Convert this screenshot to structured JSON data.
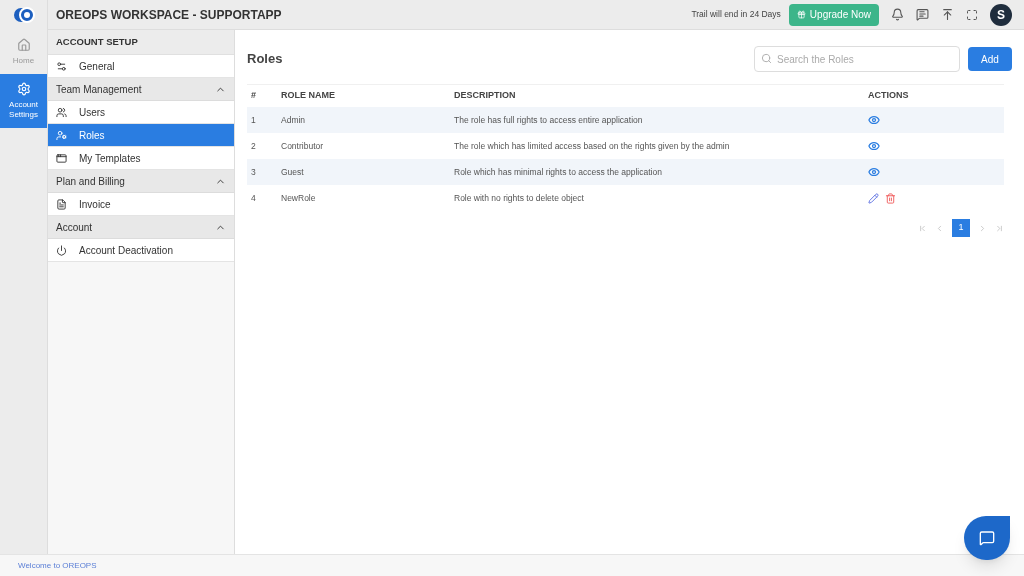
{
  "header": {
    "title": "OREOPS WORKSPACE - SUPPORTAPP",
    "trial_notice": "Trail will end in 24 Days",
    "upgrade_button": "Upgrade Now",
    "avatar": "S"
  },
  "rail": [
    {
      "label": "Home",
      "kind": "home",
      "selected": false
    },
    {
      "label": "Account Settings",
      "kind": "settings",
      "selected": true
    }
  ],
  "sidebar": {
    "title": "ACCOUNT SETUP",
    "top_items": [
      {
        "label": "General",
        "kind": "general",
        "selected": false
      }
    ],
    "sections": [
      {
        "label": "Team Management",
        "expanded": true,
        "items": [
          {
            "label": "Users",
            "kind": "users",
            "selected": false
          },
          {
            "label": "Roles",
            "kind": "roles",
            "selected": true
          },
          {
            "label": "My Templates",
            "kind": "templates",
            "selected": false
          }
        ]
      },
      {
        "label": "Plan and Billing",
        "expanded": true,
        "items": [
          {
            "label": "Invoice",
            "kind": "invoice",
            "selected": false
          }
        ]
      },
      {
        "label": "Account",
        "expanded": true,
        "items": [
          {
            "label": "Account Deactivation",
            "kind": "power",
            "selected": false
          }
        ]
      }
    ]
  },
  "page": {
    "title": "Roles",
    "search": {
      "placeholder": "Search the Roles"
    },
    "add_button": "Add"
  },
  "table": {
    "columns": [
      "#",
      "ROLE NAME",
      "DESCRIPTION",
      "ACTIONS"
    ],
    "rows": [
      {
        "index": "1",
        "name": "Admin",
        "description": "The role has full rights to access entire application",
        "actions": [
          {
            "kind": "view"
          }
        ]
      },
      {
        "index": "2",
        "name": "Contributor",
        "description": "The role which has limited access based on the rights given by the admin",
        "actions": [
          {
            "kind": "view"
          }
        ]
      },
      {
        "index": "3",
        "name": "Guest",
        "description": "Role which has minimal rights to access the application",
        "actions": [
          {
            "kind": "view"
          }
        ]
      },
      {
        "index": "4",
        "name": "NewRole",
        "description": "Role with no rights to delete object",
        "actions": [
          {
            "kind": "edit"
          },
          {
            "kind": "delete"
          }
        ]
      }
    ]
  },
  "pagination": {
    "pages": [
      {
        "label": "1",
        "selected": true
      }
    ]
  },
  "footer": {
    "text": "Welcome to OREOPS"
  }
}
